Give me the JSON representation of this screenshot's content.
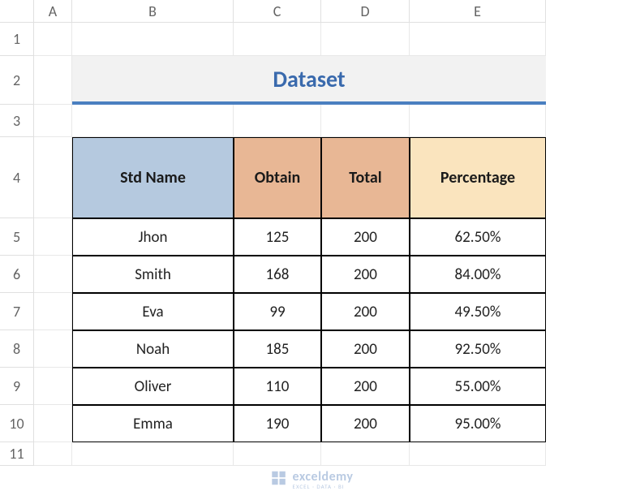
{
  "columns": [
    "A",
    "B",
    "C",
    "D",
    "E"
  ],
  "rows": [
    "1",
    "2",
    "3",
    "4",
    "5",
    "6",
    "7",
    "8",
    "9",
    "10",
    "11"
  ],
  "title": "Dataset",
  "headers": {
    "name": "Std Name",
    "obtain": "Obtain",
    "total": "Total",
    "percentage": "Percentage"
  },
  "table": [
    {
      "name": "Jhon",
      "obtain": "125",
      "total": "200",
      "percentage": "62.50%"
    },
    {
      "name": "Smith",
      "obtain": "168",
      "total": "200",
      "percentage": "84.00%"
    },
    {
      "name": "Eva",
      "obtain": "99",
      "total": "200",
      "percentage": "49.50%"
    },
    {
      "name": "Noah",
      "obtain": "185",
      "total": "200",
      "percentage": "92.50%"
    },
    {
      "name": "Oliver",
      "obtain": "110",
      "total": "200",
      "percentage": "55.00%"
    },
    {
      "name": "Emma",
      "obtain": "190",
      "total": "200",
      "percentage": "95.00%"
    }
  ],
  "watermark": {
    "brand": "exceldemy",
    "tagline": "EXCEL · DATA · BI"
  },
  "chart_data": {
    "type": "table",
    "title": "Dataset",
    "columns": [
      "Std Name",
      "Obtain",
      "Total",
      "Percentage"
    ],
    "rows": [
      [
        "Jhon",
        125,
        200,
        0.625
      ],
      [
        "Smith",
        168,
        200,
        0.84
      ],
      [
        "Eva",
        99,
        200,
        0.495
      ],
      [
        "Noah",
        185,
        200,
        0.925
      ],
      [
        "Oliver",
        110,
        200,
        0.55
      ],
      [
        "Emma",
        190,
        200,
        0.95
      ]
    ]
  }
}
